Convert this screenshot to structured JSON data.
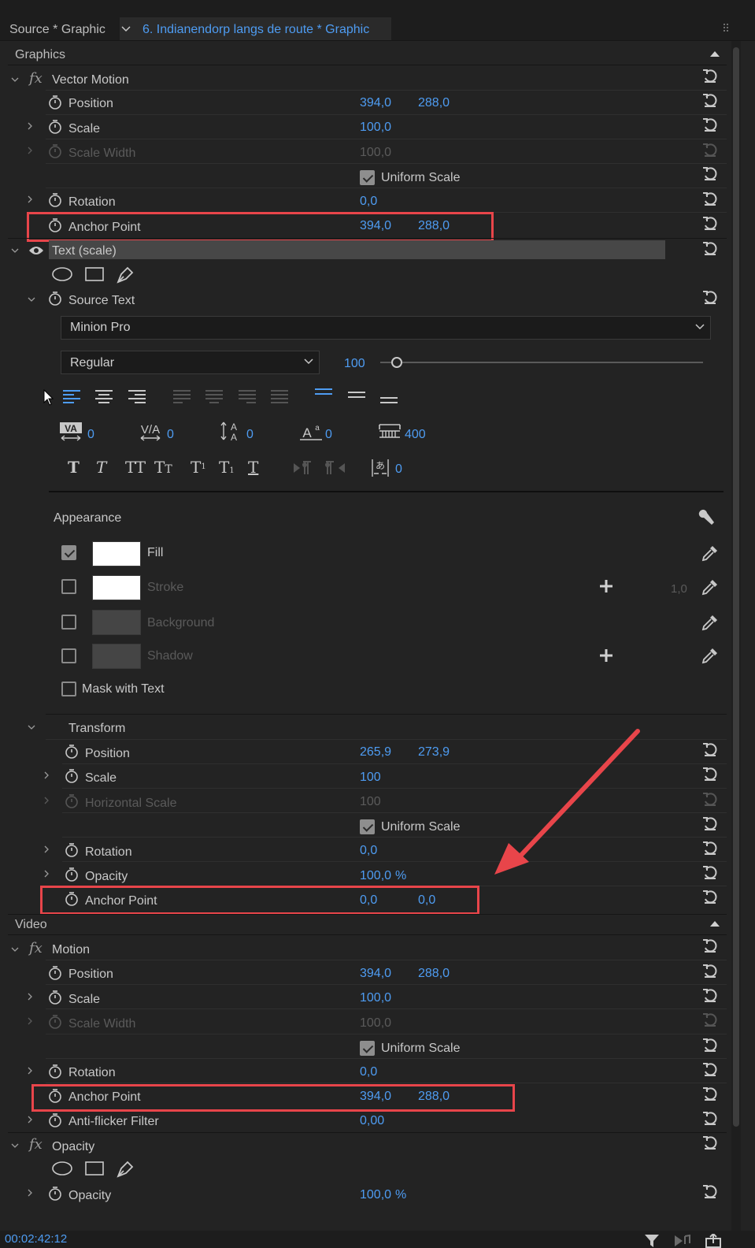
{
  "tabs": {
    "source": "Source * Graphic",
    "active": "6. Indianendorp langs de route * Graphic"
  },
  "sections": {
    "graphics": "Graphics",
    "video": "Video"
  },
  "vector_motion": {
    "title": "Vector Motion",
    "position": {
      "label": "Position",
      "x": "394,0",
      "y": "288,0"
    },
    "scale": {
      "label": "Scale",
      "value": "100,0"
    },
    "scale_width": {
      "label": "Scale Width",
      "value": "100,0"
    },
    "uniform_scale": "Uniform Scale",
    "rotation": {
      "label": "Rotation",
      "value": "0,0"
    },
    "anchor": {
      "label": "Anchor Point",
      "x": "394,0",
      "y": "288,0"
    }
  },
  "text_layer": {
    "title": "Text (scale)",
    "source_text": "Source Text",
    "font": "Minion Pro",
    "style": "Regular",
    "font_size": "100",
    "font_size_fraction": 0.05,
    "metrics": {
      "tracking": "0",
      "kerning": "0",
      "leading": "0",
      "baseline": "0",
      "tsume": "400",
      "tab_width": "0"
    },
    "appearance": {
      "title": "Appearance",
      "fill": "Fill",
      "stroke": "Stroke",
      "stroke_width": "1,0",
      "background": "Background",
      "shadow": "Shadow",
      "mask": "Mask with Text"
    },
    "transform": {
      "title": "Transform",
      "position": {
        "label": "Position",
        "x": "265,9",
        "y": "273,9"
      },
      "scale": {
        "label": "Scale",
        "value": "100"
      },
      "hscale": {
        "label": "Horizontal Scale",
        "value": "100"
      },
      "uniform_scale": "Uniform Scale",
      "rotation": {
        "label": "Rotation",
        "value": "0,0"
      },
      "opacity": {
        "label": "Opacity",
        "value": "100,0",
        "unit": "%"
      },
      "anchor": {
        "label": "Anchor Point",
        "x": "0,0",
        "y": "0,0"
      }
    }
  },
  "motion": {
    "title": "Motion",
    "position": {
      "label": "Position",
      "x": "394,0",
      "y": "288,0"
    },
    "scale": {
      "label": "Scale",
      "value": "100,0"
    },
    "scale_width": {
      "label": "Scale Width",
      "value": "100,0"
    },
    "uniform_scale": "Uniform Scale",
    "rotation": {
      "label": "Rotation",
      "value": "0,0"
    },
    "anchor": {
      "label": "Anchor Point",
      "x": "394,0",
      "y": "288,0"
    },
    "antiflicker": {
      "label": "Anti-flicker Filter",
      "value": "0,00"
    }
  },
  "opacity_fx": {
    "title": "Opacity",
    "opacity": {
      "label": "Opacity",
      "value": "100,0",
      "unit": "%"
    }
  },
  "timecode": "00:02:42:12",
  "colors": {
    "accent": "#4e9cf2",
    "highlight": "#e8454a",
    "panel": "#232323"
  }
}
